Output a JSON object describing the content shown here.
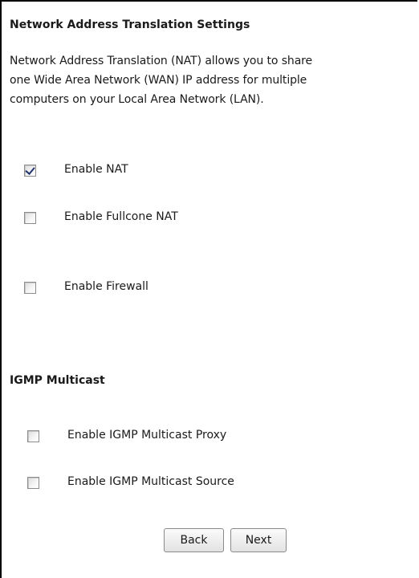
{
  "nat": {
    "heading": "Network Address Translation Settings",
    "description": [
      "Network Address Translation (NAT) allows you to share",
      "one Wide Area Network (WAN) IP address for multiple",
      "computers on your Local Area Network (LAN)."
    ],
    "options": [
      {
        "label": "Enable NAT",
        "checked": true
      },
      {
        "label": "Enable Fullcone NAT",
        "checked": false
      },
      {
        "label": "Enable Firewall",
        "checked": false
      }
    ]
  },
  "igmp": {
    "heading": "IGMP Multicast",
    "options": [
      {
        "label": "Enable IGMP Multicast Proxy",
        "checked": false
      },
      {
        "label": "Enable IGMP Multicast Source",
        "checked": false
      }
    ]
  },
  "buttons": {
    "back_label": "Back",
    "next_label": "Next"
  },
  "colors": {
    "check_mark": "#22346e",
    "border": "#000000"
  }
}
